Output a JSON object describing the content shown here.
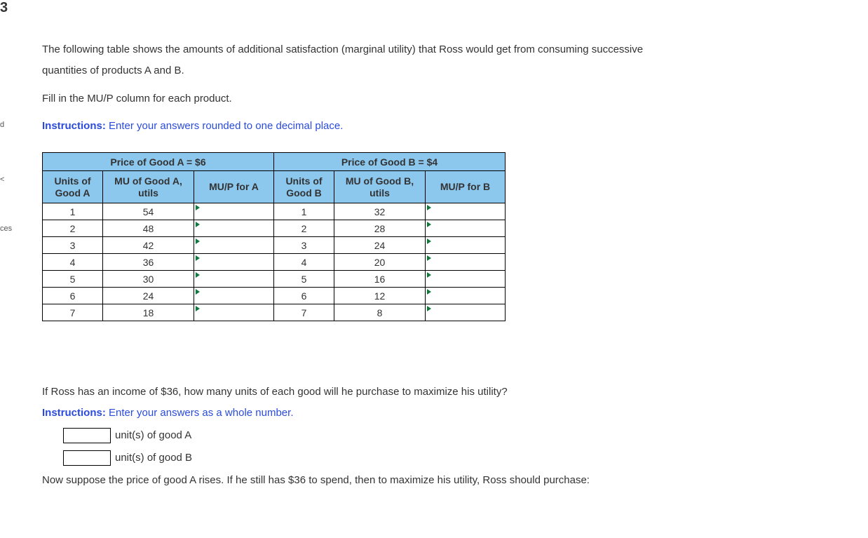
{
  "left_edge": {
    "logo_glyph": "3",
    "items": [
      "d",
      "<",
      "ces"
    ]
  },
  "intro": {
    "line1": "The following table shows the amounts of additional satisfaction (marginal utility) that Ross would get from consuming successive",
    "line2": "quantities of products A and B.",
    "fill": "Fill in the MU/P column for each product.",
    "instructions_label": "Instructions:",
    "instructions_text": "Enter your answers rounded to one decimal place."
  },
  "table": {
    "price_a": "Price of Good A = $6",
    "price_b": "Price of Good B = $4",
    "headers": {
      "units_a": "Units of\nGood A",
      "mu_a": "MU of Good A,\nutils",
      "mup_a": "MU/P for A",
      "units_b": "Units of\nGood B",
      "mu_b": "MU of Good B,\nutils",
      "mup_b": "MU/P for B"
    },
    "rows": [
      {
        "ua": "1",
        "mua": "54",
        "mupa": "",
        "ub": "1",
        "mub": "32",
        "mupb": ""
      },
      {
        "ua": "2",
        "mua": "48",
        "mupa": "",
        "ub": "2",
        "mub": "28",
        "mupb": ""
      },
      {
        "ua": "3",
        "mua": "42",
        "mupa": "",
        "ub": "3",
        "mub": "24",
        "mupb": ""
      },
      {
        "ua": "4",
        "mua": "36",
        "mupa": "",
        "ub": "4",
        "mub": "20",
        "mupb": ""
      },
      {
        "ua": "5",
        "mua": "30",
        "mupa": "",
        "ub": "5",
        "mub": "16",
        "mupb": ""
      },
      {
        "ua": "6",
        "mua": "24",
        "mupa": "",
        "ub": "6",
        "mub": "12",
        "mupb": ""
      },
      {
        "ua": "7",
        "mua": "18",
        "mupa": "",
        "ub": "7",
        "mub": "8",
        "mupb": ""
      }
    ]
  },
  "q2": {
    "text": "If Ross has an income of $36, how many units of each good will he purchase to maximize his utility?",
    "instructions_label": "Instructions:",
    "instructions_text": "Enter your answers as a whole number.",
    "good_a_label": "unit(s) of good A",
    "good_b_label": "unit(s) of good B",
    "good_a_value": "",
    "good_b_value": ""
  },
  "final": "Now suppose the price of good A rises. If he still has $36 to spend, then to maximize his utility, Ross should purchase:"
}
